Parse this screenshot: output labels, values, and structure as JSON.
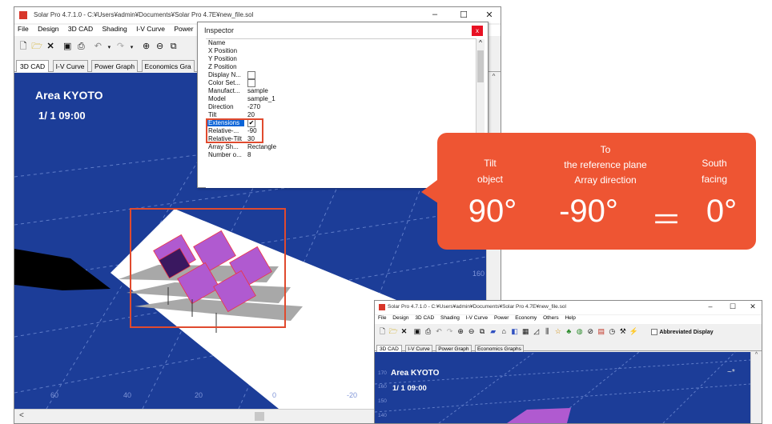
{
  "main_window": {
    "title": "Solar Pro 4.7.1.0 - C:¥Users¥admin¥Documents¥Solar Pro 4.7E¥new_file.sol",
    "menu": [
      "File",
      "Design",
      "3D CAD",
      "Shading",
      "I-V Curve",
      "Power"
    ],
    "tabs": [
      "3D CAD",
      "I-V Curve",
      "Power Graph",
      "Economics Gra"
    ],
    "area_label": "Area KYOTO",
    "time_label": "1/ 1 09:00",
    "axis_bottom": [
      "60",
      "40",
      "20",
      "0",
      "-20"
    ],
    "axis_right": [
      "160"
    ],
    "scroll_left": "<"
  },
  "inspector": {
    "title": "Inspector",
    "close": "x",
    "rows": [
      {
        "key": "Name",
        "value": ""
      },
      {
        "key": "X Position",
        "value": ""
      },
      {
        "key": "Y Position",
        "value": ""
      },
      {
        "key": "Z Position",
        "value": ""
      },
      {
        "key": "Display N...",
        "value": ""
      },
      {
        "key": "Color Set...",
        "value": ""
      },
      {
        "key": "Manufact...",
        "value": "sample"
      },
      {
        "key": "Model",
        "value": "sample_1"
      },
      {
        "key": "Direction",
        "value": "-270"
      },
      {
        "key": "Tilt",
        "value": "20"
      },
      {
        "key": "Extensions",
        "value": "✔"
      },
      {
        "key": "Relative-...",
        "value": "-90"
      },
      {
        "key": "Relative-Tilt",
        "value": "30"
      },
      {
        "key": "Array Sh...",
        "value": "Rectangle"
      },
      {
        "key": "Number o...",
        "value": "8"
      }
    ]
  },
  "callout": {
    "col1_label": "Tilt\nobject",
    "col2_label": "To\nthe reference plane\nArray direction",
    "col3_label": "South\nfacing",
    "value1": "90°",
    "value2": "-90°",
    "equals": "＝",
    "value3": "0°",
    "color": "#ee5533"
  },
  "second_window": {
    "title": "Solar Pro 4.7.1.0 - C:¥Users¥admin¥Documents¥Solar Pro 4.7E¥new_file.sol",
    "menu": [
      "File",
      "Design",
      "3D CAD",
      "Shading",
      "I-V Curve",
      "Power",
      "Economy",
      "Others",
      "Help"
    ],
    "abbreviated_display": "Abbreviated Display",
    "tabs": [
      "3D CAD",
      "I-V Curve",
      "Power Graph",
      "Economics Graphs"
    ],
    "area_label": "Area KYOTO",
    "time_label": "1/ 1 09:00",
    "axis_left": [
      "170",
      "160",
      "150",
      "140"
    ]
  },
  "colors": {
    "view_bg": "#1c3d98",
    "highlight": "#e04a2e",
    "panel_purple": "#b05ad0",
    "selection_blue": "#0a64d8"
  }
}
